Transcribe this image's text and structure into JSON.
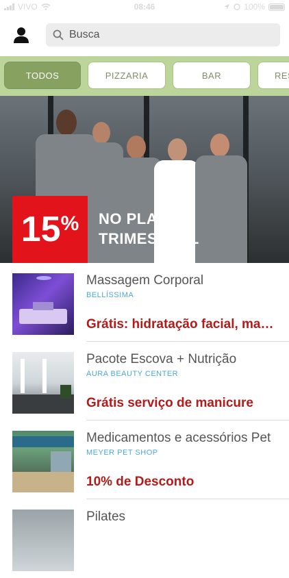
{
  "status": {
    "carrier": "VIVO",
    "time": "08:46",
    "battery": "100%"
  },
  "search": {
    "placeholder": "Busca"
  },
  "categories": [
    {
      "label": "TODOS",
      "active": true
    },
    {
      "label": "PIZZARIA",
      "active": false
    },
    {
      "label": "BAR",
      "active": false
    },
    {
      "label": "RES",
      "active": false
    }
  ],
  "banner": {
    "percent": "15",
    "percent_sign": "%",
    "line1": "NO PLANO",
    "line2": "TRIMESTRAL"
  },
  "items": [
    {
      "title": "Massagem Corporal",
      "brand": "BELLÍSSIMA",
      "offer": "Grátis: hidratação facial, manicure"
    },
    {
      "title": "Pacote Escova + Nutrição",
      "brand": "AURA BEAUTY CENTER",
      "offer": "Grátis serviço de manicure"
    },
    {
      "title": "Medicamentos e acessórios Pet",
      "brand": "MEYER PET SHOP",
      "offer": "10% de Desconto"
    },
    {
      "title": "Pilates",
      "brand": "",
      "offer": ""
    }
  ],
  "colors": {
    "accent_green": "#87a161",
    "category_bar": "#bcd59a",
    "offer_red": "#b31b1b",
    "brand_blue": "#4aa8d8",
    "badge_red": "#e3131b"
  }
}
